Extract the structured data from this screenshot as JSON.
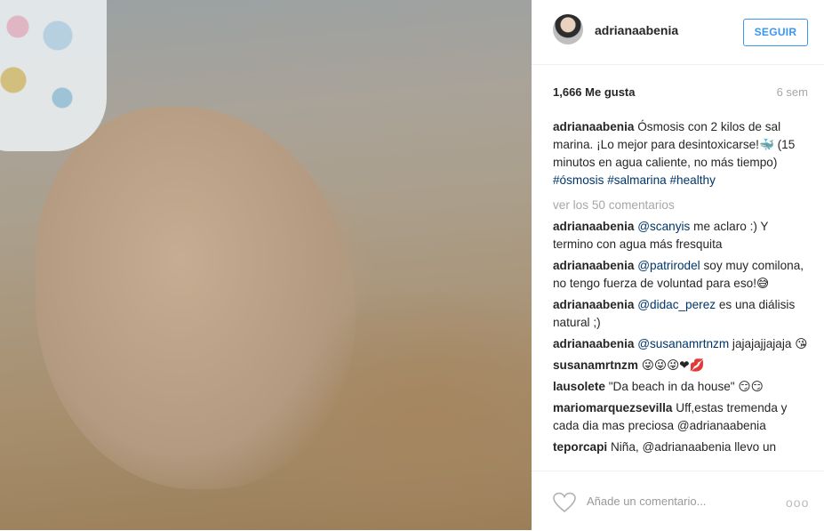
{
  "post": {
    "username": "adrianaabenia",
    "follow_label": "SEGUIR",
    "likes": "1,666 Me gusta",
    "time": "6 sem"
  },
  "caption": {
    "user": "adrianaabenia",
    "text": "Ósmosis con 2 kilos de sal marina. ¡Lo mejor para desintoxicarse!🐳 (15 minutos en agua caliente, no más tiempo) ",
    "tags": [
      "#ósmosis",
      "#salmarina",
      "#healthy"
    ]
  },
  "view_all": "ver los 50 comentarios",
  "comments": [
    {
      "user": "adrianaabenia",
      "mention": "@scanyis",
      "text": " me aclaro :) Y termino con agua más fresquita"
    },
    {
      "user": "adrianaabenia",
      "mention": "@patrirodel",
      "text": " soy muy comilona, no tengo fuerza de voluntad para eso!😅"
    },
    {
      "user": "adrianaabenia",
      "mention": "@didac_perez",
      "text": " es una diálisis natural ;)"
    },
    {
      "user": "adrianaabenia",
      "mention": "@susanamrtnzm",
      "text": " jajajajjajaja 😘"
    },
    {
      "user": "susanamrtnzm",
      "mention": "",
      "text": " 😜😜😜❤💋"
    },
    {
      "user": "lausolete",
      "mention": "",
      "text": " \"Da beach in da house\" 😏😏"
    },
    {
      "user": "mariomarquezsevilla",
      "mention": "",
      "text": " Uff,estas tremenda y cada dia mas preciosa @adrianaabenia"
    },
    {
      "user": "teporcapi",
      "mention": "",
      "text": " Niña, @adrianaabenia llevo un"
    }
  ],
  "comment_bar": {
    "placeholder": "Añade un comentario...",
    "more": "ooo"
  }
}
